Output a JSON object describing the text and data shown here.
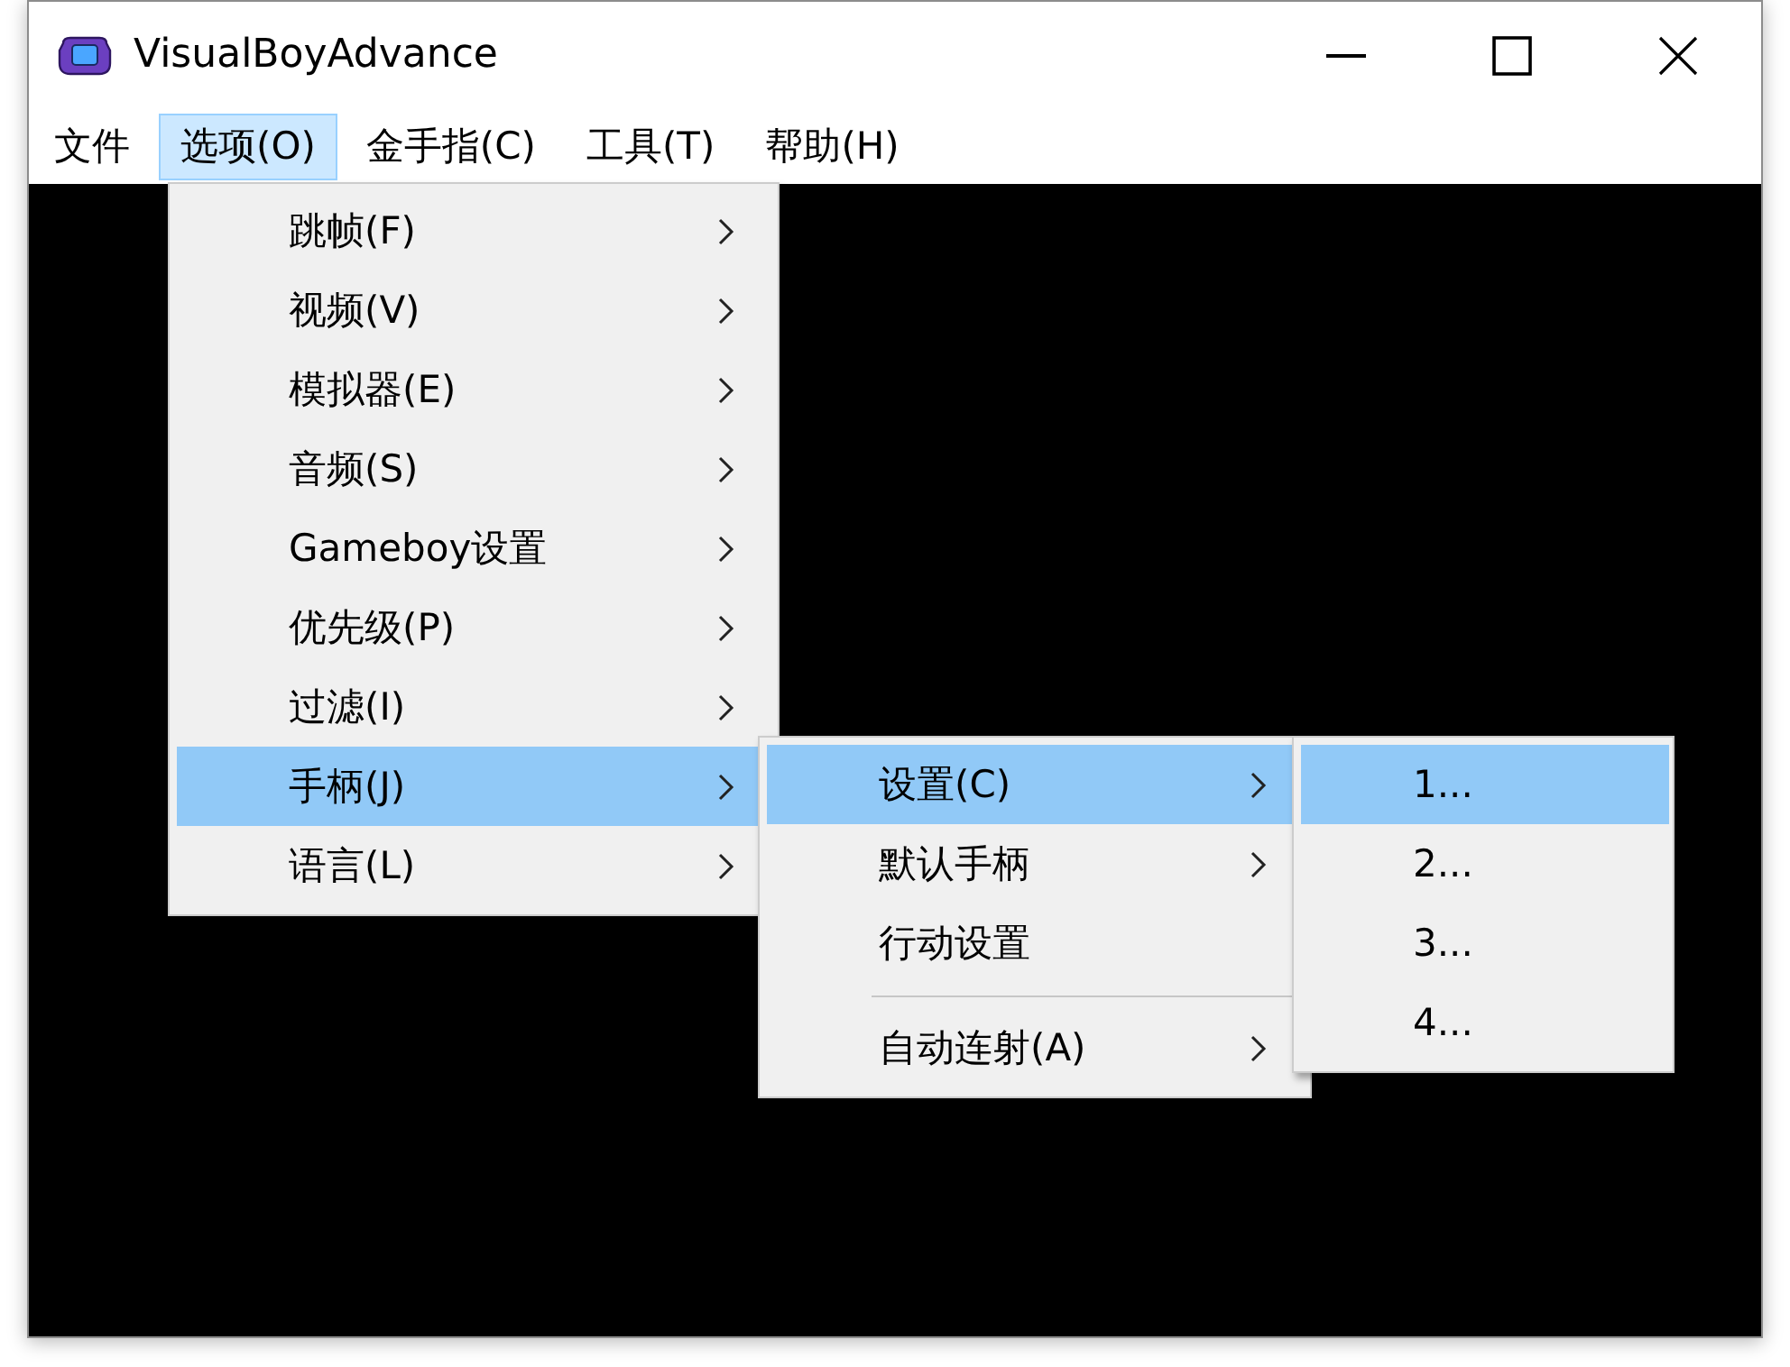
{
  "window": {
    "title": "VisualBoyAdvance"
  },
  "menu_bar": [
    {
      "label": "文件",
      "selected": false
    },
    {
      "label": "选项(O)",
      "selected": true
    },
    {
      "label": "金手指(C)",
      "selected": false
    },
    {
      "label": "工具(T)",
      "selected": false
    },
    {
      "label": "帮助(H)",
      "selected": false
    }
  ],
  "menus": [
    {
      "items": [
        {
          "kind": "item",
          "label": "跳帧(F)",
          "submenu": true,
          "selected": false
        },
        {
          "kind": "item",
          "label": "视频(V)",
          "submenu": true,
          "selected": false
        },
        {
          "kind": "item",
          "label": "模拟器(E)",
          "submenu": true,
          "selected": false
        },
        {
          "kind": "item",
          "label": "音频(S)",
          "submenu": true,
          "selected": false
        },
        {
          "kind": "item",
          "label": "Gameboy设置",
          "submenu": true,
          "selected": false
        },
        {
          "kind": "item",
          "label": "优先级(P)",
          "submenu": true,
          "selected": false
        },
        {
          "kind": "item",
          "label": "过滤(I)",
          "submenu": true,
          "selected": false
        },
        {
          "kind": "item",
          "label": "手柄(J)",
          "submenu": true,
          "selected": true
        },
        {
          "kind": "item",
          "label": "语言(L)",
          "submenu": true,
          "selected": false
        }
      ]
    },
    {
      "items": [
        {
          "kind": "item",
          "label": "设置(C)",
          "submenu": true,
          "selected": true
        },
        {
          "kind": "item",
          "label": "默认手柄",
          "submenu": true,
          "selected": false
        },
        {
          "kind": "item",
          "label": "行动设置",
          "submenu": false,
          "selected": false
        },
        {
          "kind": "separator"
        },
        {
          "kind": "item",
          "label": "自动连射(A)",
          "submenu": true,
          "selected": false
        }
      ]
    },
    {
      "items": [
        {
          "kind": "item",
          "label": "1...",
          "submenu": false,
          "selected": true
        },
        {
          "kind": "item",
          "label": "2...",
          "submenu": false,
          "selected": false
        },
        {
          "kind": "item",
          "label": "3...",
          "submenu": false,
          "selected": false
        },
        {
          "kind": "item",
          "label": "4...",
          "submenu": false,
          "selected": false
        }
      ]
    }
  ]
}
